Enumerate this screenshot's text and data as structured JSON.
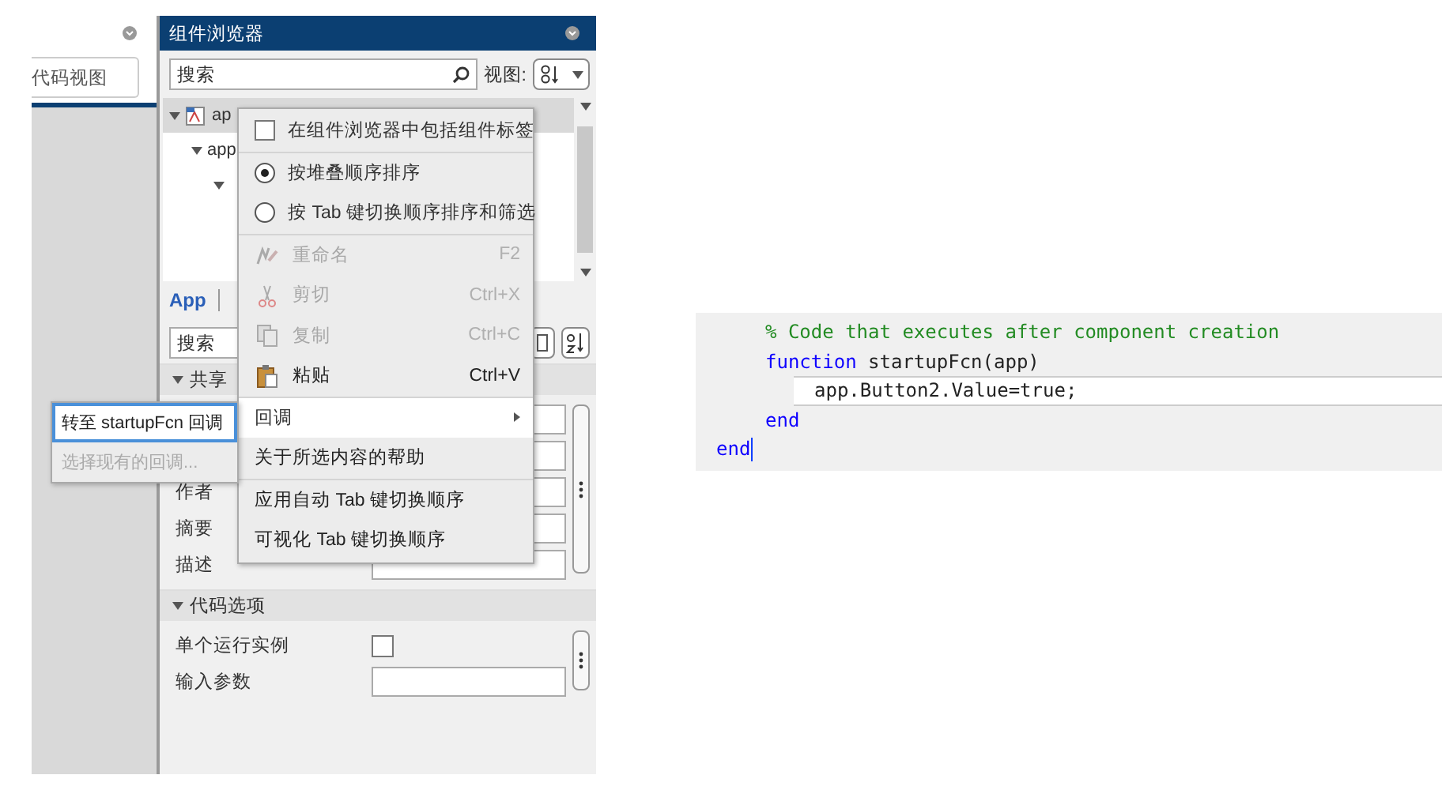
{
  "left_panel": {
    "field_value": "代码视图"
  },
  "component_browser": {
    "title": "组件浏览器",
    "search": {
      "placeholder": "搜索"
    },
    "view_label": "视图:",
    "tree": [
      {
        "label": "ap",
        "expanded": true,
        "selected": true,
        "children": [
          {
            "label": "app",
            "expanded": true,
            "children": [
              {
                "expanded": true
              }
            ]
          }
        ]
      }
    ],
    "tabs": [
      {
        "label": "App",
        "selected": true
      }
    ],
    "inspector_search": {
      "placeholder": "搜索"
    },
    "sections": [
      {
        "title": "共享",
        "expanded": true,
        "rows": [
          {
            "kind": "field"
          },
          {
            "kind": "field"
          },
          {
            "label": "作者",
            "kind": "field"
          },
          {
            "label": "摘要",
            "kind": "field"
          },
          {
            "label": "描述",
            "kind": "field"
          }
        ]
      },
      {
        "title": "代码选项",
        "expanded": true,
        "rows": [
          {
            "label": "单个运行实例",
            "kind": "checkbox",
            "checked": false
          },
          {
            "label": "输入参数",
            "kind": "field"
          }
        ]
      }
    ]
  },
  "context_menu": [
    {
      "kind": "check",
      "label": "在组件浏览器中包括组件标签",
      "checked": false
    },
    {
      "kind": "separator"
    },
    {
      "kind": "radio",
      "label": "按堆叠顺序排序",
      "selected": true
    },
    {
      "kind": "radio",
      "label": "按 Tab 键切换顺序排序和筛选",
      "selected": false
    },
    {
      "kind": "separator"
    },
    {
      "kind": "rename",
      "label": "重命名",
      "shortcut": "F2",
      "disabled": true
    },
    {
      "kind": "cut",
      "label": "剪切",
      "shortcut": "Ctrl+X",
      "disabled": true
    },
    {
      "kind": "copy",
      "label": "复制",
      "shortcut": "Ctrl+C",
      "disabled": true
    },
    {
      "kind": "paste",
      "label": "粘贴",
      "shortcut": "Ctrl+V",
      "disabled": false
    },
    {
      "kind": "separator"
    },
    {
      "kind": "submenu",
      "label": "回调",
      "highlighted": true
    },
    {
      "kind": "command",
      "label": "关于所选内容的帮助",
      "disabled": false
    },
    {
      "kind": "separator"
    },
    {
      "kind": "command",
      "label": "应用自动 Tab 键切换顺序",
      "disabled": false
    },
    {
      "kind": "command",
      "label": "可视化 Tab 键切换顺序",
      "disabled": false
    }
  ],
  "submenu": [
    {
      "label": "转至 startupFcn 回调",
      "disabled": false,
      "highlighted": true
    },
    {
      "label": "选择现有的回调...",
      "disabled": true,
      "highlighted": false
    }
  ],
  "code": [
    {
      "children": [
        {
          "current": false,
          "parts": [
            {
              "text": "% Code that executes after component creation",
              "kind": "comment"
            }
          ]
        },
        {
          "current": false,
          "parts": [
            {
              "text": "function",
              "kind": "keyword"
            },
            {
              "text": " startupFcn(app)",
              "kind": "plain"
            }
          ],
          "children": [
            {
              "current": true,
              "parts": [
                {
                  "text": "app.Button2.Value=true;",
                  "kind": "plain"
                }
              ]
            }
          ]
        },
        {
          "current": false,
          "parts": [
            {
              "text": "end",
              "kind": "keyword"
            }
          ]
        }
      ]
    },
    {
      "current": false,
      "cursor": true,
      "parts": [
        {
          "text": "end",
          "kind": "keyword"
        }
      ]
    }
  ]
}
